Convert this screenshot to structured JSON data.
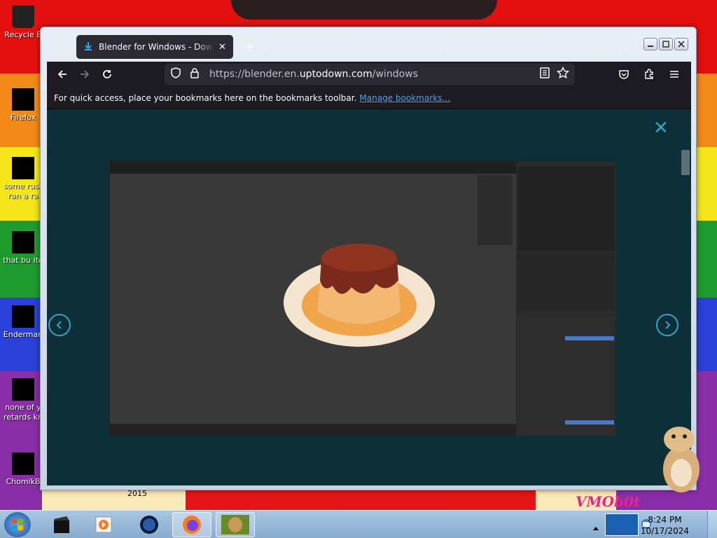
{
  "desktop": {
    "icons": [
      {
        "label": "Recycle B",
        "icon": "recycle-bin-icon"
      },
      {
        "label": "Firefox",
        "icon": "firefox-icon"
      },
      {
        "label": "some russ ran a ra",
        "icon": "document-icon"
      },
      {
        "label": "that bu ite",
        "icon": "folder-icon"
      },
      {
        "label": "Enderman",
        "icon": "app-icon"
      },
      {
        "label": "none of y retards kn",
        "icon": "app-icon"
      },
      {
        "label": "ChomikB",
        "icon": "app-icon"
      }
    ],
    "wallpaper_text": {
      "year": "2015",
      "sig": "VMOb0t"
    }
  },
  "browser": {
    "tab_title": "Blender for Windows - Download",
    "tab_close": "✕",
    "new_tab": "+",
    "url_prefix": "https://blender.en.",
    "url_domain": "uptodown.com",
    "url_path": "/windows",
    "bookmarks_message": "For quick access, place your bookmarks here on the bookmarks toolbar.",
    "bookmarks_link": "Manage bookmarks…"
  },
  "gallery": {
    "close": "✕",
    "prev_icon": "chevron-left-icon",
    "next_icon": "chevron-right-icon"
  },
  "taskbar": {
    "time": "8:24 PM",
    "date": "10/17/2024",
    "pinned": [
      "cmd-icon",
      "media-player-icon",
      "globe-icon",
      "firefox-icon",
      "box-app-icon"
    ]
  },
  "colors": {
    "accent": "#3aa0c8",
    "link": "#45a1ff",
    "browser_dark": "#1c1b22",
    "gallery_bg": "#0d3038"
  }
}
